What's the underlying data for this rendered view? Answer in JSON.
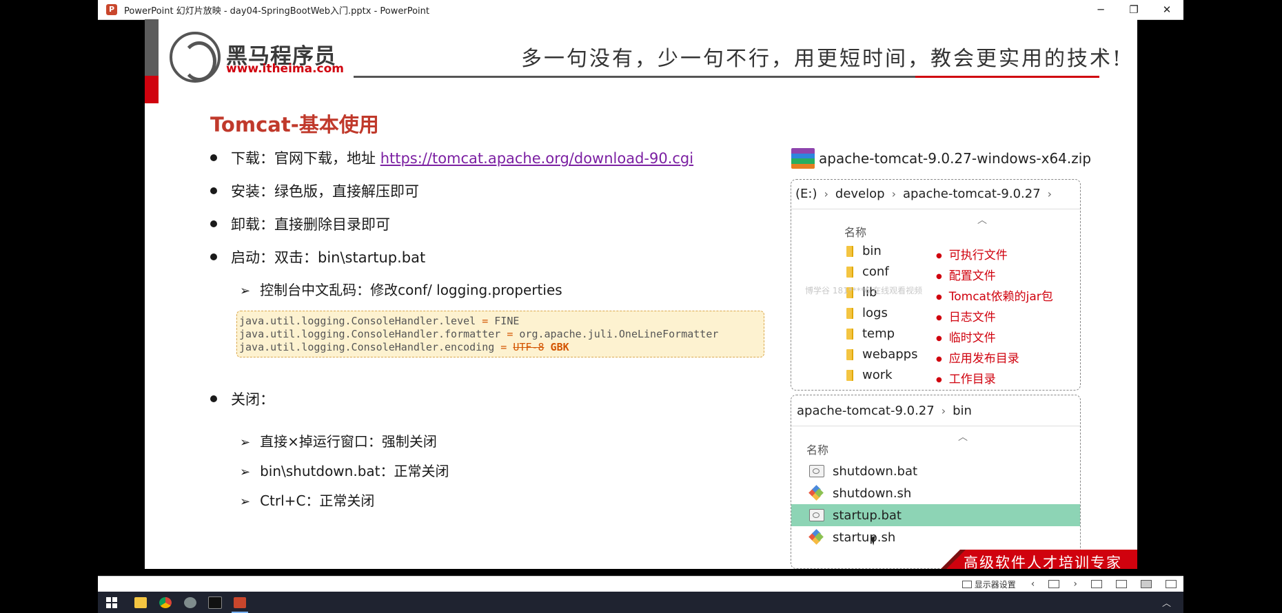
{
  "window": {
    "title": "PowerPoint 幻灯片放映  -  day04-SpringBootWeb入门.pptx - PowerPoint",
    "app_icon": "P",
    "buttons": {
      "minimize": "─",
      "restore": "❐",
      "close": "✕"
    }
  },
  "slide": {
    "logo": {
      "name": "黑马程序员",
      "url": "www.itheima.com"
    },
    "slogan": "多一句没有，少一句不行，用更短时间，教会更实用的技术!",
    "title": "Tomcat-基本使用",
    "bullets": {
      "download_prefix": "下载：官网下载，地址 ",
      "download_link": "https://tomcat.apache.org/download-90.cgi",
      "install": "安装：绿色版，直接解压即可",
      "uninstall": "卸载：直接删除目录即可",
      "start": "启动：双击：bin\\startup.bat",
      "start_sub": "控制台中文乱码：修改conf/ logging.properties",
      "close": "关闭：",
      "close_sub": [
        "直接×掉运行窗口：强制关闭",
        "bin\\shutdown.bat：正常关闭",
        "Ctrl+C：正常关闭"
      ]
    },
    "code": {
      "line1_key": "java.util.logging.ConsoleHandler.level",
      "line1_op": " = ",
      "line1_val": "FINE",
      "line2_key": "java.util.logging.ConsoleHandler.formatter",
      "line2_op": " = ",
      "line2_val": "org.apache.juli.OneLineFormatter",
      "line3_key": "java.util.logging.ConsoleHandler.encoding",
      "line3_op": " = ",
      "line3_old": "UTF-8",
      "line3_new": " GBK"
    },
    "zip_file": "apache-tomcat-9.0.27-windows-x64.zip",
    "explorer_top": {
      "crumbs": [
        "(E:)",
        "develop",
        "apache-tomcat-9.0.27"
      ],
      "column": "名称",
      "folders": [
        "bin",
        "conf",
        "lib",
        "logs",
        "temp",
        "webapps",
        "work"
      ],
      "notes": [
        "可执行文件",
        "配置文件",
        "Tomcat依赖的jar包",
        "日志文件",
        "临时文件",
        "应用发布目录",
        "工作目录"
      ],
      "watermark": "博学谷 181****6 在线观看视频"
    },
    "explorer_bottom": {
      "crumbs": [
        "apache-tomcat-9.0.27",
        "bin"
      ],
      "column": "名称",
      "files": [
        "shutdown.bat",
        "shutdown.sh",
        "startup.bat",
        "startup.sh"
      ],
      "selected": "startup.bat"
    },
    "footer": "高级软件人才培训专家"
  },
  "statusbar": {
    "display_settings": "显示器设置"
  },
  "colors": {
    "brand_red": "#d0020e",
    "title_red": "#c0392b",
    "link": "#7b1fa2",
    "selected_row": "#8dd4b5"
  }
}
